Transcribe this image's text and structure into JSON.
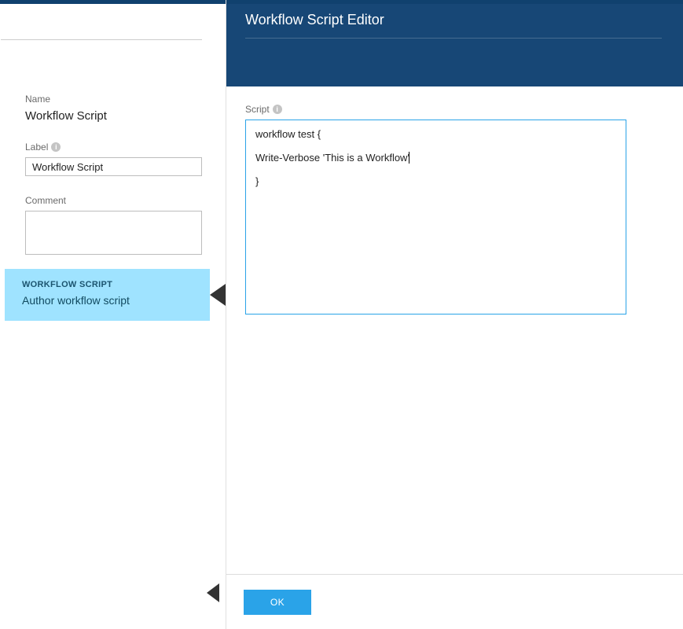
{
  "left": {
    "name_label": "Name",
    "name_value": "Workflow Script",
    "label_label": "Label",
    "label_value": "Workflow Script",
    "comment_label": "Comment",
    "comment_value": "",
    "section": {
      "title": "WORKFLOW SCRIPT",
      "subtitle": "Author workflow script"
    }
  },
  "right": {
    "header_title": "Workflow Script Editor",
    "script_label": "Script",
    "script_lines": [
      "workflow test {",
      "",
      "Write-Verbose 'This is a Workflow'",
      "",
      "}"
    ],
    "ok_label": "OK"
  }
}
